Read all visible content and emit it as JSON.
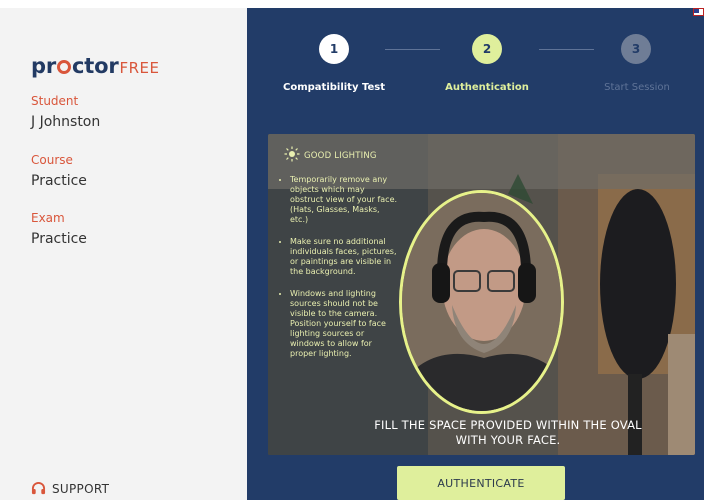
{
  "logo": {
    "part1": "pr",
    "part2": "ctor",
    "part3": "FREE"
  },
  "sidebar": {
    "fields": [
      {
        "label": "Student",
        "value": "J Johnston"
      },
      {
        "label": "Course",
        "value": "Practice"
      },
      {
        "label": "Exam",
        "value": "Practice"
      }
    ],
    "support_label": "SUPPORT"
  },
  "steps": [
    {
      "number": "1",
      "label": "Compatibility Test",
      "state": "done"
    },
    {
      "number": "2",
      "label": "Authentication",
      "state": "active"
    },
    {
      "number": "3",
      "label": "Start Session",
      "state": "pending"
    }
  ],
  "instructions": {
    "heading": "GOOD LIGHTING",
    "items": [
      "Temporarily remove any objects which may obstruct view of your face. (Hats, Glasses, Masks, etc.)",
      "Make sure no additional individuals faces, pictures, or paintings are visible in the background.",
      "Windows and lighting sources should not be visible to the camera. Position yourself to face lighting sources or windows to allow for proper lighting."
    ]
  },
  "caption": {
    "line1": "FILL THE SPACE PROVIDED WITHIN THE OVAL",
    "line2": "WITH YOUR FACE."
  },
  "authenticate_label": "AUTHENTICATE",
  "colors": {
    "accent": "#d9563b",
    "navy": "#223c68",
    "highlight": "#dfef9c"
  },
  "icons": {
    "support": "headset-icon",
    "lighting": "sun-icon"
  }
}
